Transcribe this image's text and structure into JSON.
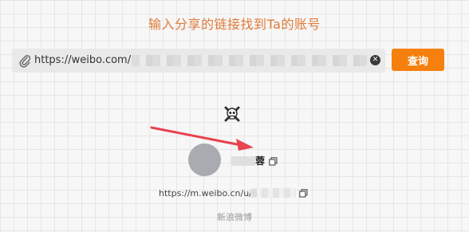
{
  "page": {
    "title": "输入分享的链接找到Ta的账号"
  },
  "search": {
    "value": "https://weibo.com/",
    "clear_icon": "close-circle-icon",
    "link_icon": "paperclip-icon",
    "button_label": "查询"
  },
  "result": {
    "name": "蓉",
    "profile_url": "https://m.weibo.cn/u/6",
    "platform": "新浪微博",
    "copy_icon": "copy-icon",
    "marker_icon": "skull-icon"
  },
  "colors": {
    "title": "#e07b39",
    "button": "#f5800d",
    "arrow": "#e8434f",
    "avatar": "#a9abb0"
  }
}
